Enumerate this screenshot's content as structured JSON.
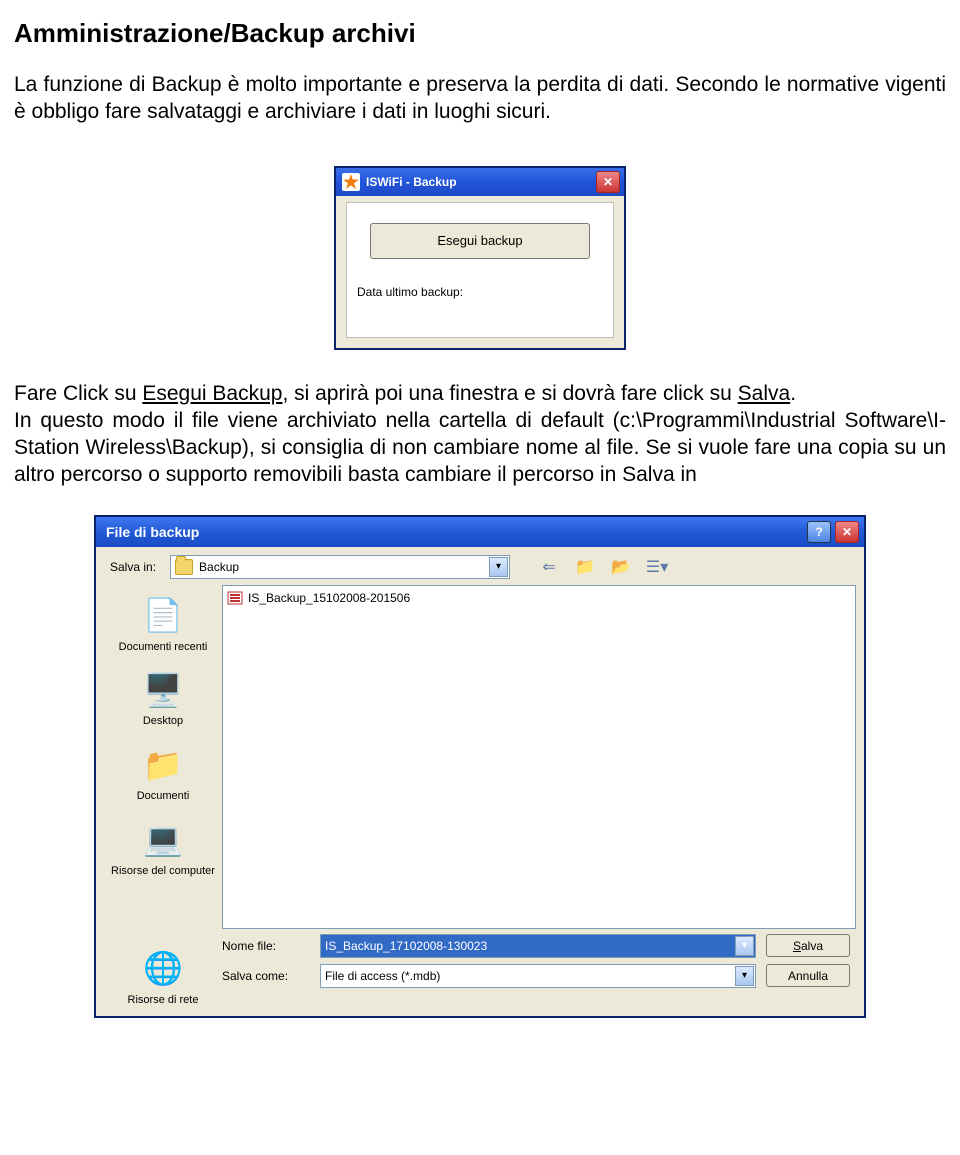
{
  "heading": "Amministrazione/Backup archivi",
  "intro_part1": "La funzione di Backup è molto importante e preserva la perdita di dati. Secondo le normative vigenti è obbligo fare salvataggi e archiviare i dati in luoghi sicuri.",
  "mid_prefix": "Fare Click su ",
  "mid_u1": "Esegui Backup",
  "mid_mid": ", si aprirà poi una finestra e si dovrà fare click su ",
  "mid_u2": "Salva",
  "mid_end": ".",
  "mid_rest": "In questo modo il file viene archiviato nella cartella di default (c:\\Programmi\\Industrial Software\\I-Station Wireless\\Backup), si consiglia di non cambiare nome al file. Se si vuole fare una copia su un altro percorso o supporto removibili basta cambiare il percorso in Salva in",
  "dlg1": {
    "title": "ISWiFi - Backup",
    "button": "Esegui backup",
    "last_label": "Data ultimo backup:"
  },
  "dlg2": {
    "title": "File di backup",
    "salva_in_label": "Salva in:",
    "folder_name": "Backup",
    "file_shown": "IS_Backup_15102008-201506",
    "places": {
      "recent": "Documenti recenti",
      "desktop": "Desktop",
      "docs": "Documenti",
      "comp": "Risorse del computer",
      "net": "Risorse di rete"
    },
    "name_label": "Nome file:",
    "name_value": "IS_Backup_17102008-130023",
    "type_label": "Salva come:",
    "type_value": "File di access (*.mdb)",
    "save_btn_prefix": "S",
    "save_btn_rest": "alva",
    "cancel_btn": "Annulla"
  }
}
